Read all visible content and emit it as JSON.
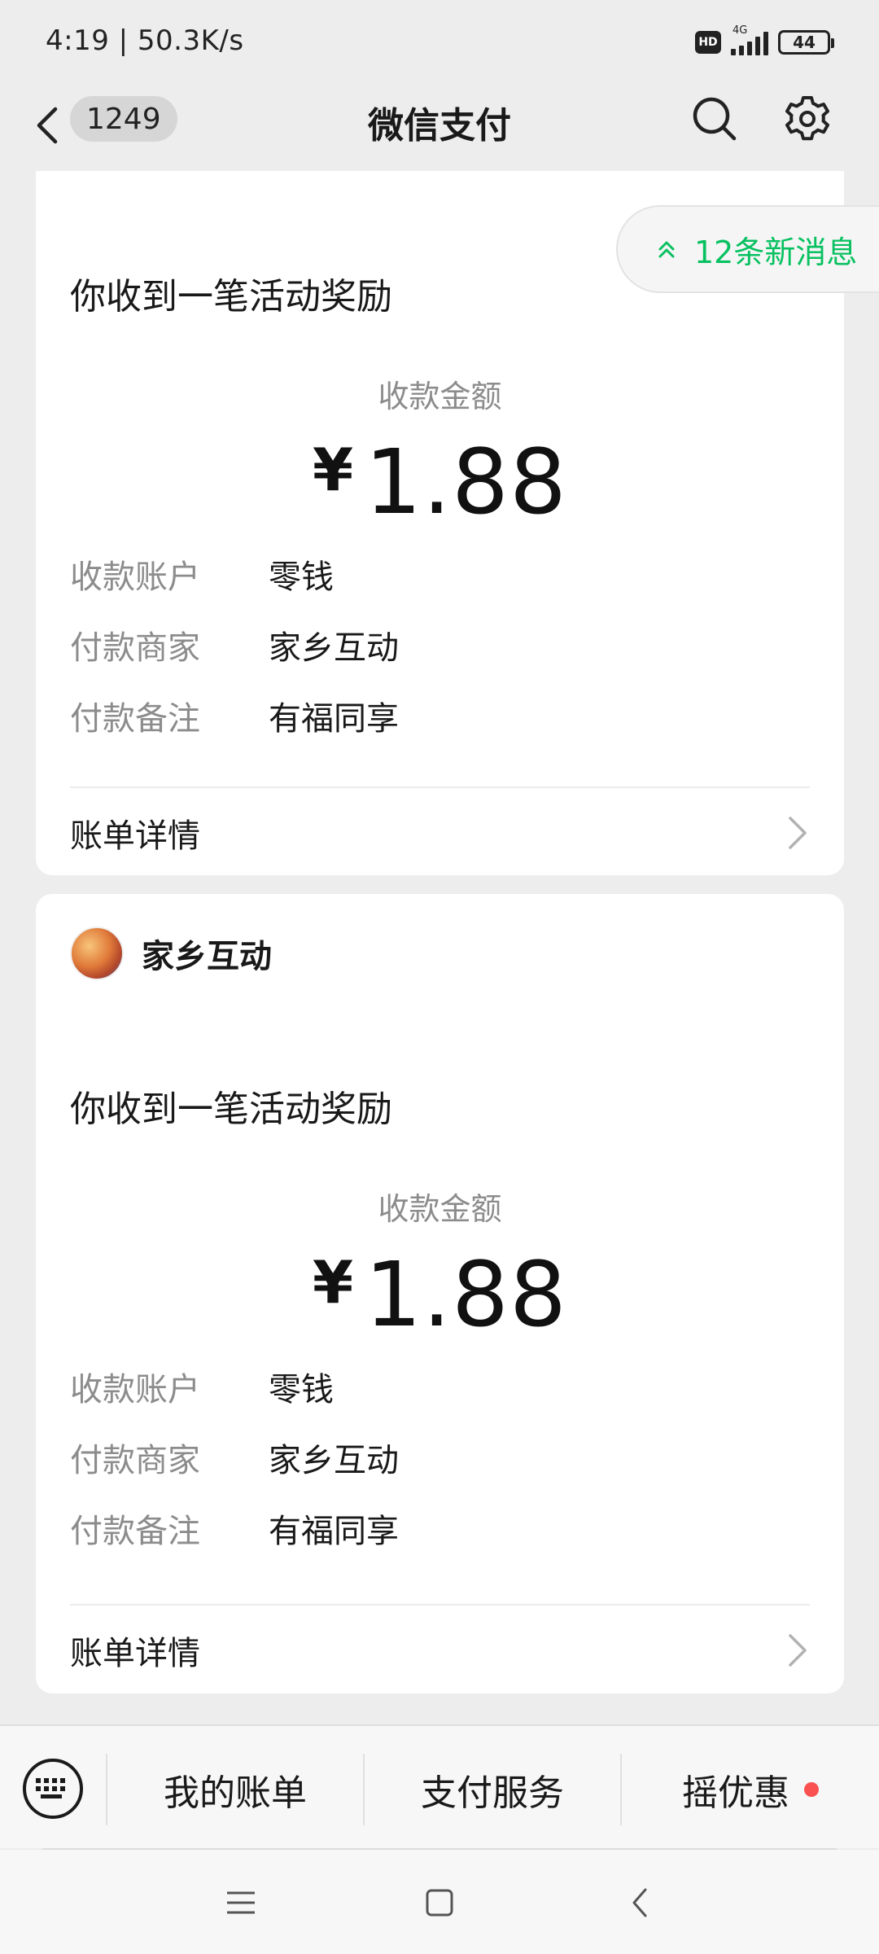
{
  "status_bar": {
    "time": "4:19 | 50.3K/s",
    "hd": "HD",
    "network": "4G",
    "battery": "44"
  },
  "header": {
    "unread_count": "1249",
    "title": "微信支付"
  },
  "new_messages": {
    "label": "12条新消息",
    "color": "#07c160"
  },
  "cards": [
    {
      "heading": "你收到一笔活动奖励",
      "amount_label": "收款金额",
      "currency": "¥",
      "amount": "1.88",
      "rows": [
        {
          "key": "收款账户",
          "value": "零钱"
        },
        {
          "key": "付款商家",
          "value": "家乡互动"
        },
        {
          "key": "付款备注",
          "value": "有福同享"
        }
      ],
      "detail_label": "账单详情"
    },
    {
      "merchant": "家乡互动",
      "heading": "你收到一笔活动奖励",
      "amount_label": "收款金额",
      "currency": "¥",
      "amount": "1.88",
      "rows": [
        {
          "key": "收款账户",
          "value": "零钱"
        },
        {
          "key": "付款商家",
          "value": "家乡互动"
        },
        {
          "key": "付款备注",
          "value": "有福同享"
        }
      ],
      "detail_label": "账单详情"
    }
  ],
  "bottom_menu": {
    "items": [
      {
        "label": "我的账单"
      },
      {
        "label": "支付服务"
      },
      {
        "label": "摇优惠"
      }
    ],
    "badge_color": "#fa5151"
  },
  "icons": {
    "back": "chevron-left-icon",
    "search": "search-icon",
    "settings": "gear-icon",
    "keyboard": "keyboard-icon",
    "nav_menu": "menu-icon",
    "nav_home": "home-icon",
    "nav_back": "back-icon"
  }
}
